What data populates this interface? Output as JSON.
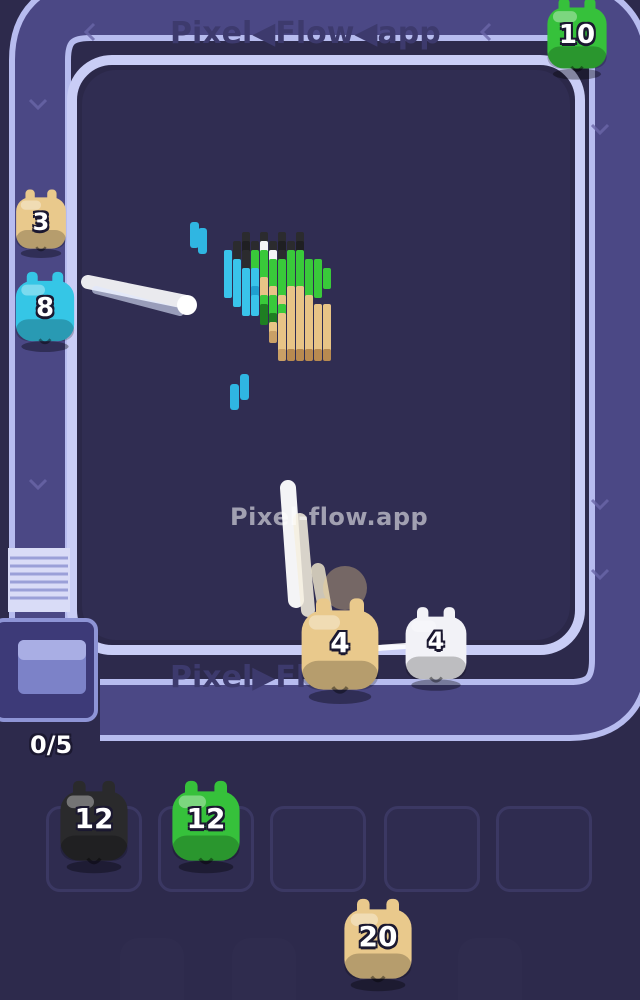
{
  "watermark": "Pixel-flow.app",
  "track_watermark_top": "Pixel◀Flow◀app",
  "track_watermark_bottom": "Pixel▶Flow",
  "track_watermark_right": "Pixel◀Flow◀app",
  "queue_counter": "0/5",
  "colors": {
    "background": "#2d2a4c",
    "track": "#7f86c9",
    "cream": "#e9c98c",
    "cyan": "#35c6e6",
    "green": "#36c13b",
    "black": "#2a2a2c",
    "white": "#f2f2f7"
  },
  "track_shooters": [
    {
      "name": "cream-shooter",
      "color": "cream",
      "count": "3"
    },
    {
      "name": "cyan-shooter",
      "color": "cyan",
      "count": "8"
    },
    {
      "name": "green-shooter-corner",
      "color": "green",
      "count": "10"
    },
    {
      "name": "cream-shooter-bottom",
      "color": "cream",
      "count": "4"
    },
    {
      "name": "white-shooter-bottom",
      "color": "white",
      "count": "4"
    }
  ],
  "queue_slots": [
    {
      "color": "black",
      "count": "12"
    },
    {
      "color": "green",
      "count": "12"
    },
    {
      "color": "empty",
      "count": ""
    },
    {
      "color": "empty",
      "count": ""
    },
    {
      "color": "empty",
      "count": ""
    }
  ],
  "next_shooter": {
    "color": "cream",
    "count": "20"
  }
}
